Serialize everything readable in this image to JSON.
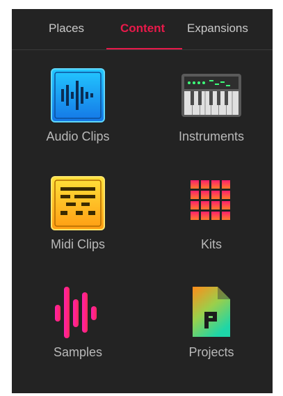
{
  "tabs": [
    {
      "label": "Places",
      "active": false
    },
    {
      "label": "Content",
      "active": true
    },
    {
      "label": "Expansions",
      "active": false
    }
  ],
  "accent_color": "#e8194a",
  "items": [
    {
      "label": "Audio Clips",
      "icon": "audio-clip-icon"
    },
    {
      "label": "Instruments",
      "icon": "keyboard-icon"
    },
    {
      "label": "Midi Clips",
      "icon": "midi-clip-icon"
    },
    {
      "label": "Kits",
      "icon": "pad-grid-icon"
    },
    {
      "label": "Samples",
      "icon": "waveform-icon"
    },
    {
      "label": "Projects",
      "icon": "project-file-icon"
    }
  ]
}
